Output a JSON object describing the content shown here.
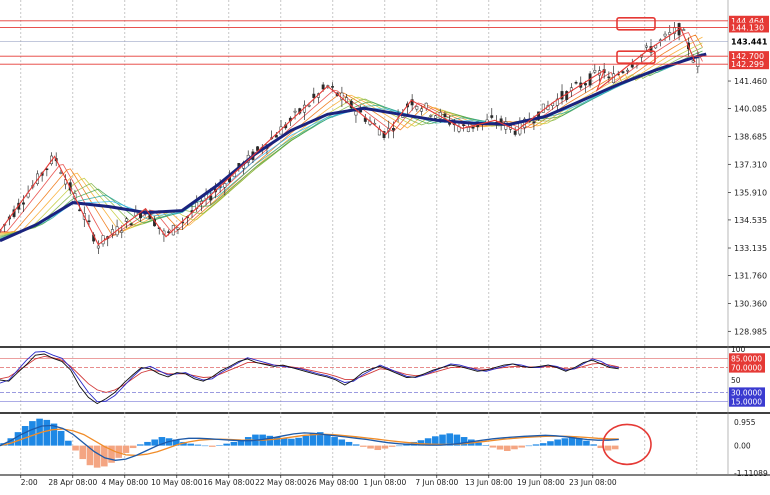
{
  "colors": {
    "background": "#ffffff",
    "grid": "#b0b0b0",
    "candle": "#2a2a2a",
    "ma_fast": "#1a237e",
    "zigzag": "#e53935",
    "level_line": "#e53935",
    "rsi_black": "#111111",
    "rsi_blue": "#2828c8",
    "rsi_red": "#d23c3c",
    "macd_bar_pos": "#1e88e5",
    "macd_bar_neg": "#f4a582",
    "macd_line": "#1e5aa8",
    "signal_line": "#f08c28",
    "annotation": "#e53935"
  },
  "chart_data": [
    {
      "type": "candlestick",
      "title": "",
      "y_ticks": [
        "141.460",
        "140.085",
        "138.685",
        "137.310",
        "135.910",
        "134.535",
        "133.135",
        "131.760",
        "130.360",
        "128.985"
      ],
      "y_ticks_values": [
        141.46,
        140.085,
        138.685,
        137.31,
        135.91,
        134.535,
        133.135,
        131.76,
        130.36,
        128.985
      ],
      "ylim": [
        128.3,
        145.25
      ],
      "price_labels": [
        "144.464",
        "144.130",
        "143.441",
        "142.700",
        "142.299"
      ],
      "price_label_values": [
        144.464,
        144.13,
        143.441,
        142.7,
        142.299
      ],
      "price_label_styles": [
        "red",
        "red",
        "dark",
        "red",
        "red"
      ],
      "current_price_marker": "143.441",
      "pivots": [
        {
          "x": 0.0,
          "y": 133.6
        },
        {
          "x": 0.02,
          "y": 134.0
        },
        {
          "x": 0.075,
          "y": 137.7
        },
        {
          "x": 0.135,
          "y": 133.3
        },
        {
          "x": 0.2,
          "y": 135.1
        },
        {
          "x": 0.228,
          "y": 133.7
        },
        {
          "x": 0.45,
          "y": 141.2
        },
        {
          "x": 0.53,
          "y": 138.8
        },
        {
          "x": 0.565,
          "y": 140.5
        },
        {
          "x": 0.635,
          "y": 139.1
        },
        {
          "x": 0.68,
          "y": 139.5
        },
        {
          "x": 0.71,
          "y": 139.0
        },
        {
          "x": 0.76,
          "y": 140.4
        },
        {
          "x": 0.83,
          "y": 142.0
        },
        {
          "x": 0.82,
          "y": 141.0
        },
        {
          "x": 0.89,
          "y": 143.0
        },
        {
          "x": 0.89,
          "y": 142.6
        },
        {
          "x": 0.935,
          "y": 144.1
        },
        {
          "x": 0.955,
          "y": 143.4
        }
      ],
      "zigzag": [
        {
          "x": 0.0,
          "y": 134.0
        },
        {
          "x": 0.075,
          "y": 137.7
        },
        {
          "x": 0.135,
          "y": 133.3
        },
        {
          "x": 0.2,
          "y": 135.1
        },
        {
          "x": 0.228,
          "y": 133.7
        },
        {
          "x": 0.45,
          "y": 141.2
        },
        {
          "x": 0.53,
          "y": 138.8
        },
        {
          "x": 0.565,
          "y": 140.5
        },
        {
          "x": 0.635,
          "y": 139.1
        },
        {
          "x": 0.68,
          "y": 139.5
        },
        {
          "x": 0.71,
          "y": 139.0
        },
        {
          "x": 0.76,
          "y": 140.4
        },
        {
          "x": 0.83,
          "y": 142.0
        },
        {
          "x": 0.82,
          "y": 141.0
        },
        {
          "x": 0.89,
          "y": 143.0
        },
        {
          "x": 0.935,
          "y": 144.1
        },
        {
          "x": 0.955,
          "y": 142.4
        }
      ],
      "ma_slow": [
        {
          "x": 0.0,
          "y": 133.5
        },
        {
          "x": 0.05,
          "y": 134.3
        },
        {
          "x": 0.1,
          "y": 135.4
        },
        {
          "x": 0.15,
          "y": 135.2
        },
        {
          "x": 0.2,
          "y": 134.9
        },
        {
          "x": 0.25,
          "y": 135.0
        },
        {
          "x": 0.3,
          "y": 136.3
        },
        {
          "x": 0.35,
          "y": 137.8
        },
        {
          "x": 0.4,
          "y": 139.0
        },
        {
          "x": 0.45,
          "y": 139.8
        },
        {
          "x": 0.5,
          "y": 140.1
        },
        {
          "x": 0.55,
          "y": 139.8
        },
        {
          "x": 0.6,
          "y": 139.5
        },
        {
          "x": 0.65,
          "y": 139.35
        },
        {
          "x": 0.7,
          "y": 139.3
        },
        {
          "x": 0.75,
          "y": 139.7
        },
        {
          "x": 0.8,
          "y": 140.5
        },
        {
          "x": 0.85,
          "y": 141.3
        },
        {
          "x": 0.9,
          "y": 142.0
        },
        {
          "x": 0.95,
          "y": 142.6
        },
        {
          "x": 0.97,
          "y": 142.8
        }
      ]
    },
    {
      "type": "line",
      "title": "",
      "y_ticks": [
        "100",
        "85.0000",
        "70.0000",
        "50",
        "30.0000",
        "15.0000"
      ],
      "y_ticks_values": [
        100,
        85,
        70,
        50,
        30,
        15
      ],
      "ylim": [
        0,
        100
      ],
      "levels": [
        85,
        70,
        30,
        15
      ],
      "series_black": [
        50,
        48,
        62,
        75,
        90,
        92,
        85,
        80,
        66,
        40,
        22,
        12,
        20,
        30,
        45,
        58,
        70,
        68,
        60,
        55,
        62,
        60,
        52,
        48,
        55,
        65,
        72,
        80,
        84,
        78,
        75,
        72,
        74,
        70,
        66,
        62,
        58,
        55,
        50,
        42,
        50,
        62,
        68,
        72,
        66,
        60,
        54,
        55,
        60,
        66,
        70,
        74,
        72,
        68,
        64,
        66,
        70,
        74,
        76,
        72,
        70,
        72,
        74,
        70,
        64,
        70,
        78,
        82,
        76,
        70,
        68
      ],
      "series_blue": [
        45,
        50,
        66,
        82,
        95,
        96,
        90,
        85,
        70,
        50,
        30,
        15,
        16,
        25,
        40,
        55,
        68,
        72,
        65,
        58,
        60,
        62,
        55,
        50,
        52,
        62,
        70,
        78,
        86,
        82,
        78,
        74,
        72,
        70,
        68,
        64,
        60,
        57,
        52,
        46,
        48,
        58,
        66,
        74,
        68,
        62,
        56,
        54,
        58,
        64,
        70,
        76,
        74,
        70,
        66,
        64,
        68,
        72,
        76,
        74,
        70,
        70,
        74,
        72,
        66,
        68,
        76,
        84,
        80,
        72,
        70
      ],
      "series_red": [
        52,
        55,
        64,
        74,
        84,
        88,
        86,
        82,
        72,
        58,
        44,
        34,
        30,
        34,
        42,
        52,
        62,
        66,
        64,
        60,
        60,
        60,
        57,
        54,
        55,
        60,
        66,
        72,
        78,
        78,
        76,
        74,
        73,
        71,
        69,
        66,
        63,
        60,
        56,
        51,
        51,
        56,
        62,
        68,
        67,
        63,
        59,
        57,
        58,
        62,
        66,
        70,
        71,
        70,
        68,
        67,
        68,
        70,
        72,
        72,
        71,
        71,
        72,
        71,
        68,
        68,
        72,
        76,
        77,
        74,
        71
      ]
    },
    {
      "type": "bar",
      "title": "",
      "y_ticks": [
        "0.955",
        "0.00",
        "-1.11089"
      ],
      "y_ticks_values": [
        0.955,
        0.0,
        -1.11089
      ],
      "ylim": [
        -1.2,
        1.25
      ],
      "histogram": [
        0.1,
        0.3,
        0.55,
        0.8,
        1.0,
        1.1,
        1.05,
        0.9,
        0.6,
        0.2,
        -0.2,
        -0.55,
        -0.8,
        -0.9,
        -0.85,
        -0.7,
        -0.5,
        -0.3,
        -0.1,
        0.05,
        0.15,
        0.25,
        0.35,
        0.3,
        0.25,
        0.15,
        0.08,
        0.04,
        0.0,
        -0.05,
        0.02,
        0.08,
        0.15,
        0.25,
        0.35,
        0.45,
        0.45,
        0.4,
        0.35,
        0.3,
        0.28,
        0.32,
        0.4,
        0.5,
        0.55,
        0.45,
        0.35,
        0.25,
        0.15,
        0.05,
        -0.05,
        -0.12,
        -0.18,
        -0.12,
        -0.05,
        0.0,
        0.08,
        0.15,
        0.22,
        0.3,
        0.38,
        0.45,
        0.5,
        0.45,
        0.35,
        0.25,
        0.12,
        0.02,
        -0.08,
        -0.16,
        -0.22,
        -0.15,
        -0.08,
        0.0,
        0.05,
        0.1,
        0.18,
        0.25,
        0.3,
        0.35,
        0.3,
        0.2,
        0.05,
        -0.1,
        -0.2,
        -0.15
      ],
      "macd_line": [
        0.0,
        0.2,
        0.45,
        0.65,
        0.8,
        0.82,
        0.7,
        0.45,
        0.1,
        -0.25,
        -0.5,
        -0.6,
        -0.55,
        -0.4,
        -0.2,
        0.0,
        0.15,
        0.25,
        0.3,
        0.3,
        0.28,
        0.25,
        0.22,
        0.2,
        0.2,
        0.25,
        0.32,
        0.4,
        0.48,
        0.52,
        0.5,
        0.45,
        0.4,
        0.35,
        0.3,
        0.25,
        0.18,
        0.12,
        0.08,
        0.05,
        0.03,
        0.02,
        0.02,
        0.05,
        0.1,
        0.16,
        0.22,
        0.28,
        0.32,
        0.35,
        0.38,
        0.4,
        0.42,
        0.4,
        0.36,
        0.3,
        0.25,
        0.22,
        0.22,
        0.25
      ],
      "signal_line": [
        0.0,
        0.1,
        0.25,
        0.4,
        0.55,
        0.65,
        0.68,
        0.6,
        0.45,
        0.2,
        -0.05,
        -0.25,
        -0.38,
        -0.4,
        -0.35,
        -0.25,
        -0.1,
        0.05,
        0.15,
        0.22,
        0.25,
        0.26,
        0.25,
        0.23,
        0.22,
        0.22,
        0.25,
        0.3,
        0.36,
        0.42,
        0.45,
        0.46,
        0.44,
        0.4,
        0.36,
        0.31,
        0.26,
        0.21,
        0.16,
        0.12,
        0.08,
        0.06,
        0.05,
        0.05,
        0.07,
        0.11,
        0.16,
        0.21,
        0.26,
        0.3,
        0.33,
        0.36,
        0.38,
        0.39,
        0.38,
        0.36,
        0.33,
        0.3,
        0.28,
        0.27
      ]
    }
  ],
  "x_axis": {
    "tick_labels": [
      "2:00",
      "28 Apr 08:00",
      "4 May 08:00",
      "10 May 08:00",
      "16 May 08:00",
      "22 May 08:00",
      "26 May 08:00",
      "1 Jun 08:00",
      "7 Jun 08:00",
      "13 Jun 08:00",
      "19 Jun 08:00",
      "23 Jun 08:00"
    ],
    "future_gridlines": 2
  },
  "annotations": {
    "boxes_on_price_labels": 2,
    "circle_on_macd": true
  }
}
